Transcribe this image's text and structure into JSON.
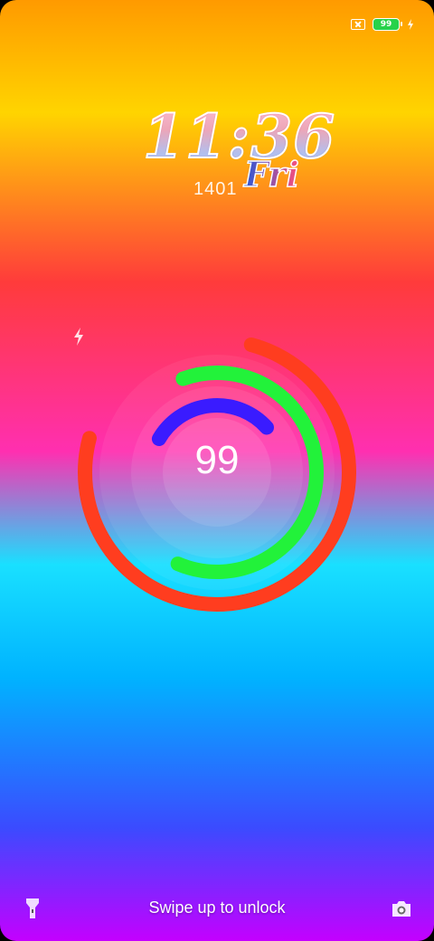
{
  "statusbar": {
    "sim_icon": "sim-missing-icon",
    "battery_level": "99",
    "charging_icon": "charging-bolt-icon",
    "battery_color": "#27d24a"
  },
  "clock": {
    "time": "11:36",
    "day": "Fri",
    "date": "1401"
  },
  "battery_widget": {
    "value": "99",
    "charging_icon": "charging-bolt-icon",
    "rings": [
      {
        "color": "#ff3d1f",
        "fraction": 0.75
      },
      {
        "color": "#22f23a",
        "fraction": 0.62
      },
      {
        "color": "#3a1bff",
        "fraction": 0.3
      }
    ]
  },
  "lockscreen": {
    "unlock_hint": "Swipe up to unlock",
    "left_shortcut_icon": "flashlight-icon",
    "right_shortcut_icon": "camera-icon"
  }
}
